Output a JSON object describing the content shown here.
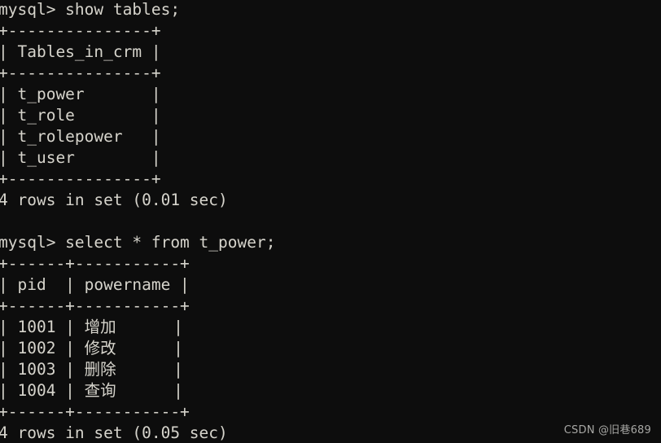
{
  "terminal": {
    "app": "mysql-client-terminal",
    "background_color": "#0d0d0d",
    "foreground_color": "#d6d4cc",
    "lines": [
      "mysql> show tables;",
      "+---------------+",
      "| Tables_in_crm |",
      "+---------------+",
      "| t_power       |",
      "| t_role        |",
      "| t_rolepower   |",
      "| t_user        |",
      "+---------------+",
      "4 rows in set (0.01 sec)",
      "",
      "mysql> select * from t_power;",
      "+------+-----------+",
      "| pid  | powername |",
      "+------+-----------+",
      "| 1001 | 增加      |",
      "| 1002 | 修改      |",
      "| 1003 | 删除      |",
      "| 1004 | 查询      |",
      "+------+-----------+",
      "4 rows in set (0.05 sec)"
    ],
    "queries": [
      {
        "prompt": "mysql>",
        "sql": "show tables;",
        "result_columns": [
          "Tables_in_crm"
        ],
        "result_rows": [
          [
            "t_power"
          ],
          [
            "t_role"
          ],
          [
            "t_rolepower"
          ],
          [
            "t_user"
          ]
        ],
        "status": "4 rows in set (0.01 sec)"
      },
      {
        "prompt": "mysql>",
        "sql": "select * from t_power;",
        "result_columns": [
          "pid",
          "powername"
        ],
        "result_rows": [
          [
            "1001",
            "增加"
          ],
          [
            "1002",
            "修改"
          ],
          [
            "1003",
            "删除"
          ],
          [
            "1004",
            "查询"
          ]
        ],
        "status": "4 rows in set (0.05 sec)"
      }
    ]
  },
  "watermark": {
    "text": "CSDN @旧巷689"
  }
}
